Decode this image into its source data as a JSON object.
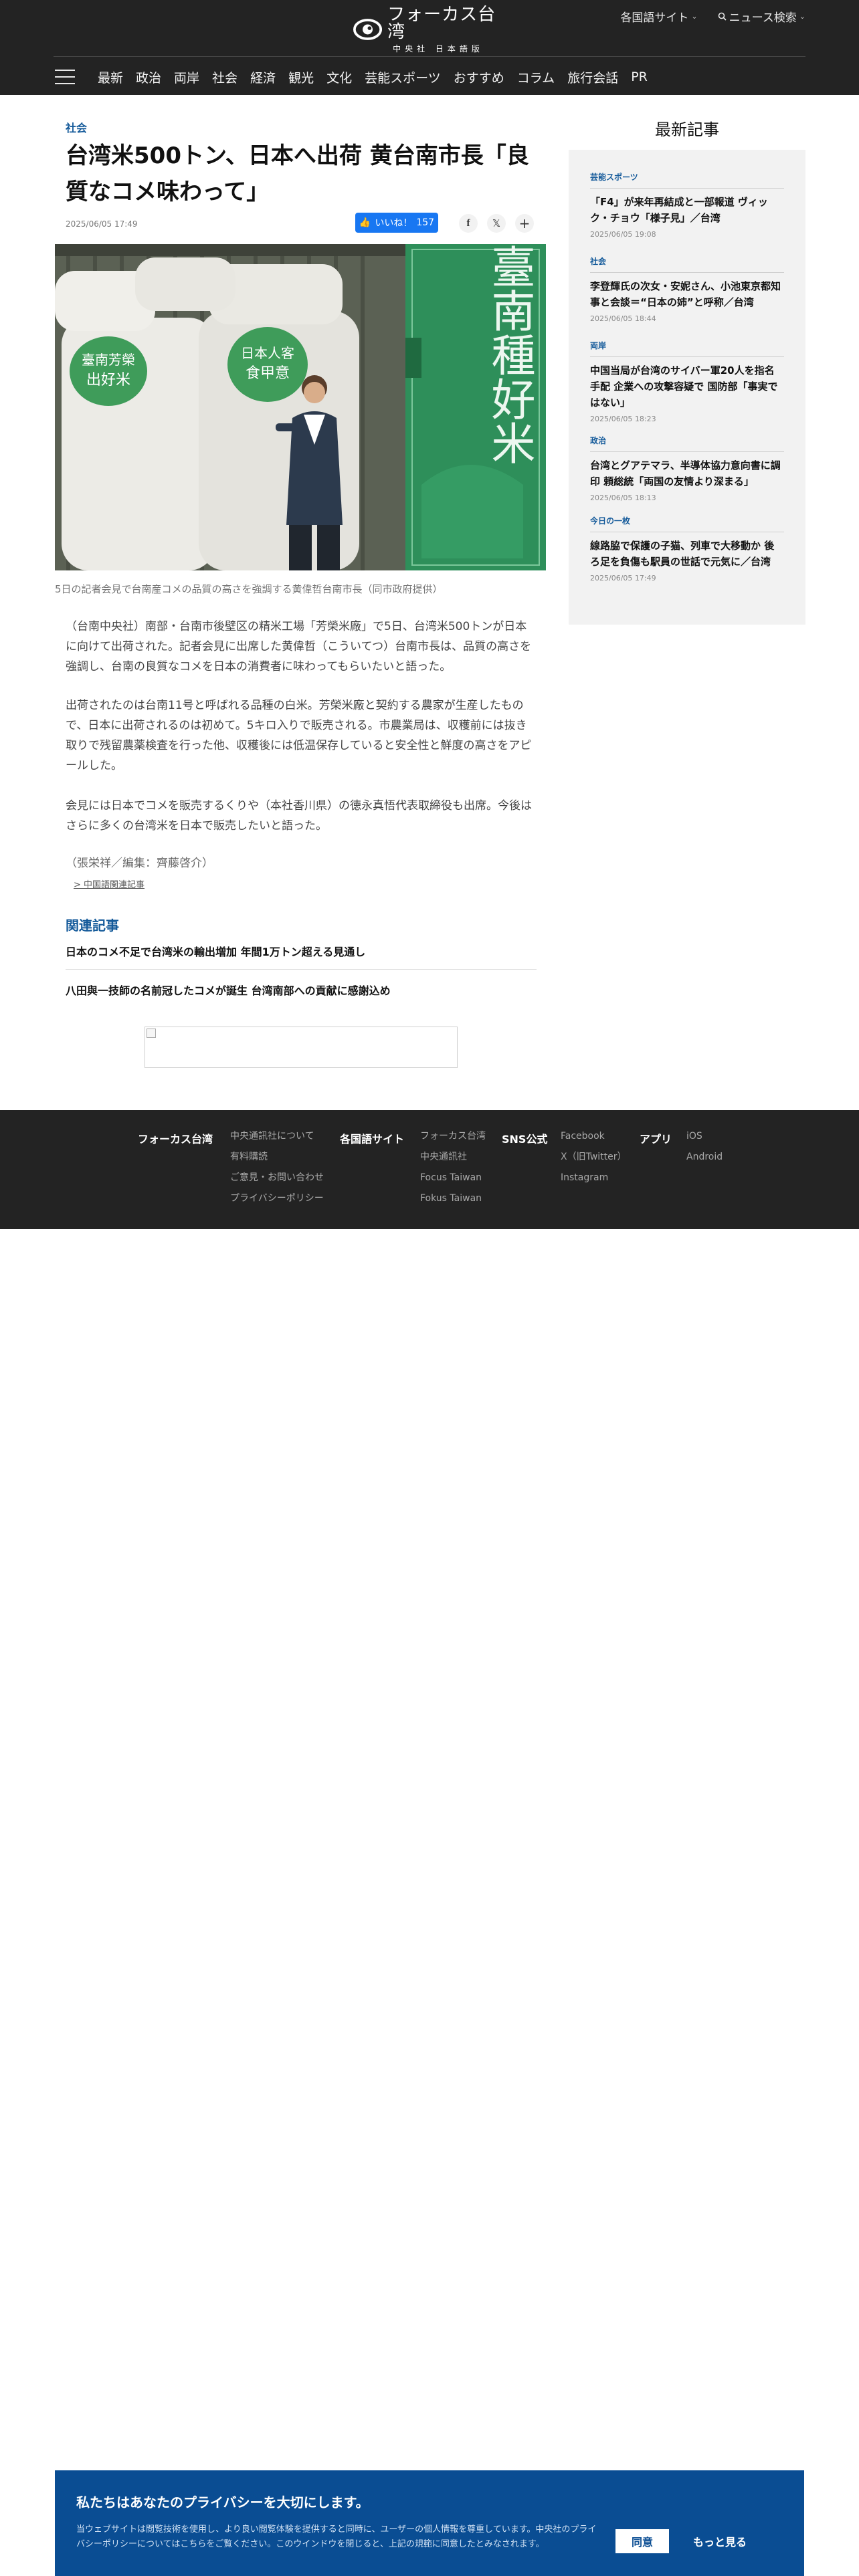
{
  "header": {
    "logo_main": "フォーカス台湾",
    "logo_sub": "中央社 日本語版",
    "lang_sites": "各国語サイト",
    "news_search": "ニュース検索",
    "nav": [
      "最新",
      "政治",
      "両岸",
      "社会",
      "経済",
      "観光",
      "文化",
      "芸能スポーツ",
      "おすすめ",
      "コラム",
      "旅行会話",
      "PR"
    ]
  },
  "article": {
    "category": "社会",
    "title": "台湾米500トン、日本へ出荷 黄台南市長「良質なコメ味わって」",
    "date": "2025/06/05 17:49",
    "like_label": "いいね！",
    "like_count": "157",
    "image": {
      "sign_main": "臺南種好米",
      "bag_left_1": "臺南芳榮",
      "bag_left_2": "出好米",
      "bag_mid_1": "日本人客",
      "bag_mid_2": "食甲意"
    },
    "caption": "5日の記者会見で台南産コメの品質の高さを強調する黄偉哲台南市長（同市政府提供）",
    "paragraphs": [
      "（台南中央社）南部・台南市後壁区の精米工場「芳榮米廠」で5日、台湾米500トンが日本に向けて出荷された。記者会見に出席した黄偉哲（こういてつ）台南市長は、品質の高さを強調し、台南の良質なコメを日本の消費者に味わってもらいたいと語った。",
      "出荷されたのは台南11号と呼ばれる品種の白米。芳榮米廠と契約する農家が生産したもので、日本に出荷されるのは初めて。5キロ入りで販売される。市農業局は、収穫前には抜き取りで残留農薬検査を行った他、収穫後には低温保存していると安全性と鮮度の高さをアピールした。",
      "会見には日本でコメを販売するくりや（本社香川県）の徳永真悟代表取締役も出席。今後はさらに多くの台湾米を日本で販売したいと語った。"
    ],
    "byline": "（張栄祥／編集：齊藤啓介）",
    "related_link": "> 中国語関連記事"
  },
  "related": {
    "heading": "関連記事",
    "items": [
      "日本のコメ不足で台湾米の輸出増加 年間1万トン超える見通し",
      "八田與一技師の名前冠したコメが誕生 台湾南部への貢献に感謝込め"
    ]
  },
  "sidebar": {
    "heading": "最新記事",
    "items": [
      {
        "cat": "芸能スポーツ",
        "title": "「F4」が来年再結成と一部報道 ヴィック・チョウ「様子見」／台湾",
        "date": "2025/06/05 19:08"
      },
      {
        "cat": "社会",
        "title": "李登輝氏の次女・安妮さん、小池東京都知事と会談＝“日本の姉”と呼称／台湾",
        "date": "2025/06/05 18:44"
      },
      {
        "cat": "両岸",
        "title": "中国当局が台湾のサイバー軍20人を指名手配 企業への攻撃容疑で 国防部「事実ではない」",
        "date": "2025/06/05 18:23"
      },
      {
        "cat": "政治",
        "title": "台湾とグアテマラ、半導体協力意向書に調印 頼総統「両国の友情より深まる」",
        "date": "2025/06/05 18:13"
      },
      {
        "cat": "今日の一枚",
        "title": "線路脇で保護の子猫、列車で大移動か 後ろ足を負傷も駅員の世話で元気に／台湾",
        "date": "2025/06/05 17:49"
      }
    ]
  },
  "footer": {
    "columns": [
      {
        "head": "フォーカス台湾",
        "links": [
          "中央通訊社について",
          "有料購読",
          "ご意見・お問い合わせ",
          "プライバシーポリシー"
        ]
      },
      {
        "head": "各国語サイト",
        "links": [
          "フォーカス台湾",
          "中央通訊社",
          "Focus Taiwan",
          "Fokus Taiwan"
        ]
      },
      {
        "head": "SNS公式",
        "links": [
          "Facebook",
          "X（旧Twitter）",
          "Instagram"
        ]
      },
      {
        "head": "アプリ",
        "links": [
          "iOS",
          "Android"
        ]
      }
    ]
  },
  "cookie": {
    "title": "私たちはあなたのプライバシーを大切にします。",
    "text": "当ウェブサイトは閲覧技術を使用し、より良い閲覧体験を提供すると同時に、ユーザーの個人情報を尊重しています。中央社のプライバシーポリシーについてはこちらをご覧ください。このウインドウを閉じると、上記の規範に同意したとみなされます。",
    "agree": "同意",
    "more": "もっと見る"
  },
  "colors": {
    "header_bg": "#232323",
    "accent_blue": "#145a9a",
    "like_blue": "#1877f2",
    "cookie_bg": "#0a4d93",
    "sign_green": "#2e8f5a"
  }
}
